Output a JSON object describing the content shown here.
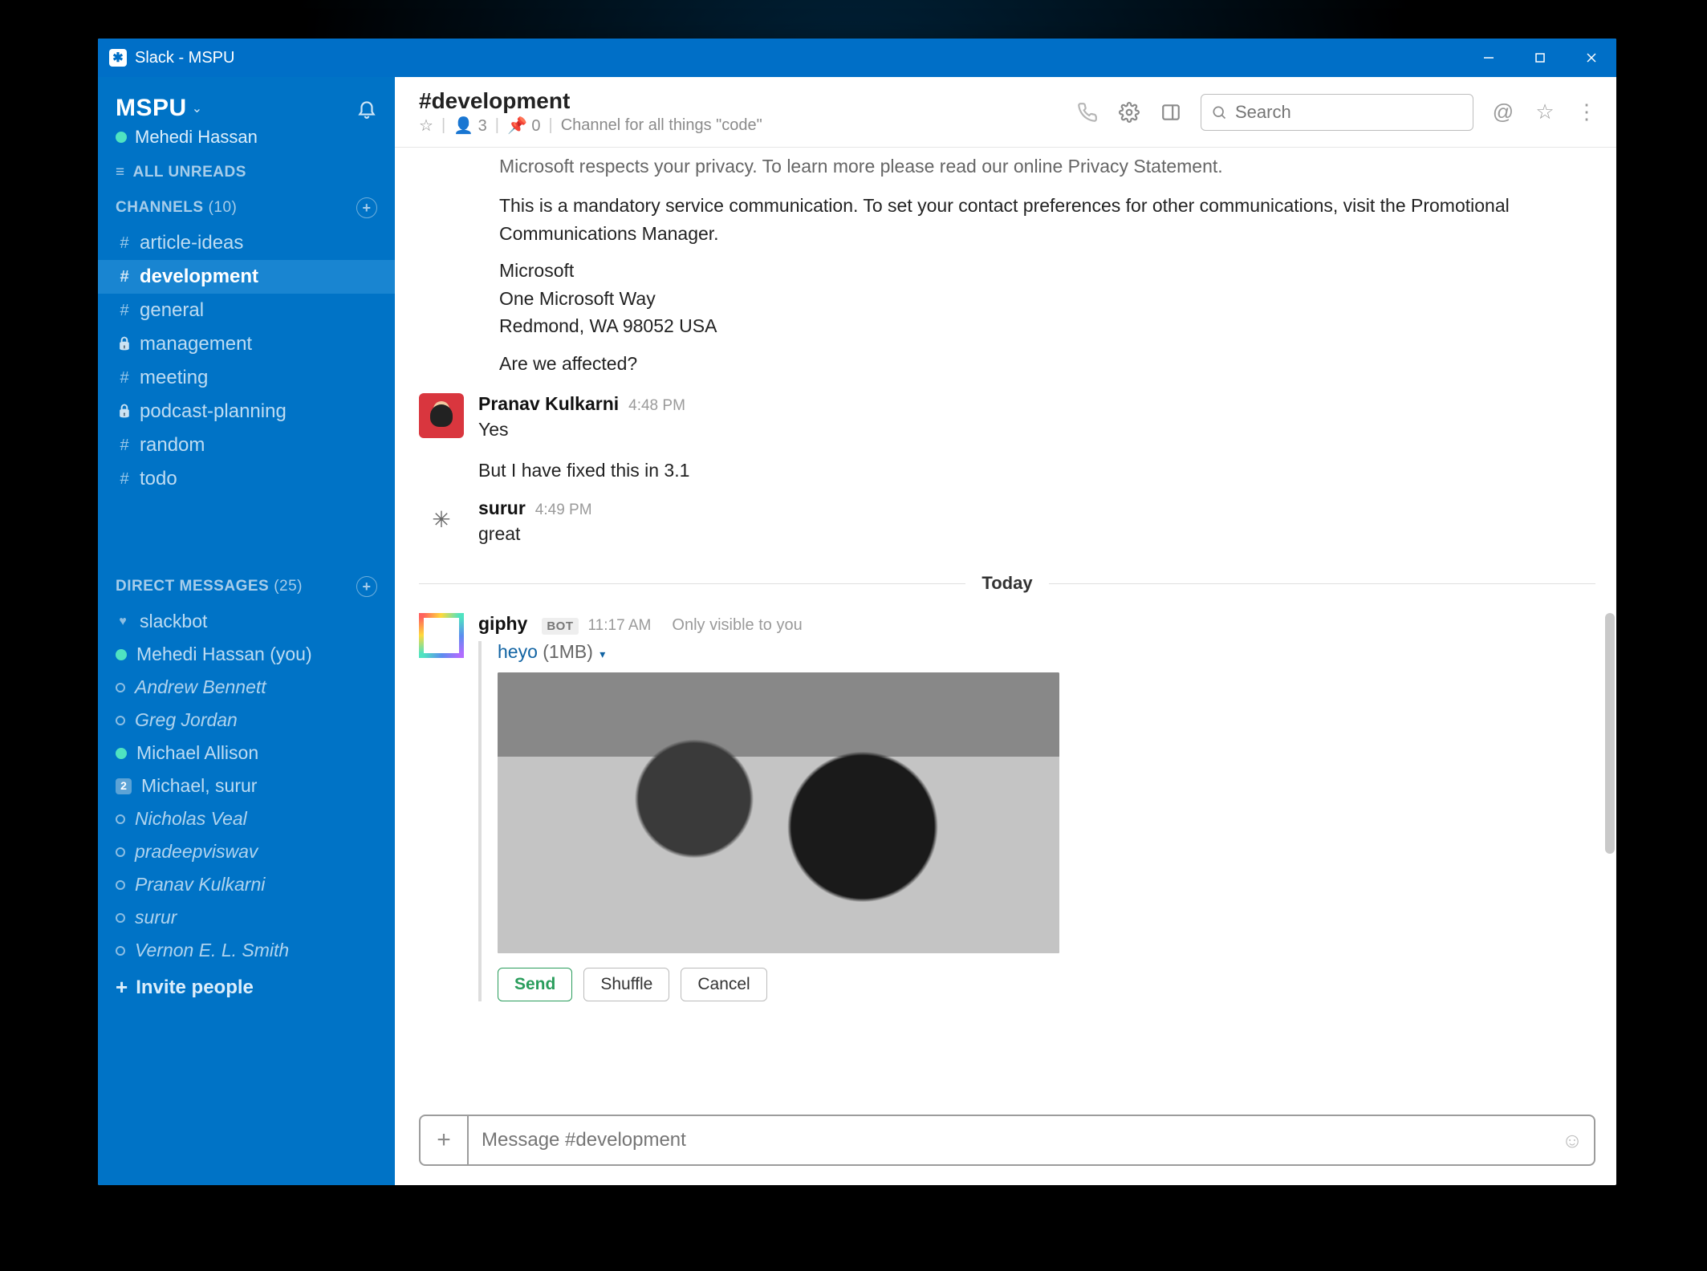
{
  "window": {
    "title": "Slack - MSPU"
  },
  "workspace": {
    "name": "MSPU",
    "user": "Mehedi Hassan"
  },
  "sidebar": {
    "allunreads": "ALL UNREADS",
    "channels_label": "CHANNELS",
    "channels_count": "(10)",
    "channels": [
      {
        "name": "article-ideas",
        "type": "hash"
      },
      {
        "name": "development",
        "type": "hash",
        "active": true
      },
      {
        "name": "general",
        "type": "hash"
      },
      {
        "name": "management",
        "type": "lock"
      },
      {
        "name": "meeting",
        "type": "hash"
      },
      {
        "name": "podcast-planning",
        "type": "lock"
      },
      {
        "name": "random",
        "type": "hash"
      },
      {
        "name": "todo",
        "type": "hash"
      }
    ],
    "dm_label": "DIRECT MESSAGES",
    "dm_count": "(25)",
    "dms": [
      {
        "name": "slackbot",
        "pre": "heart"
      },
      {
        "name": "Mehedi Hassan (you)",
        "pre": "dot-on"
      },
      {
        "name": "Andrew Bennett",
        "pre": "dot-off",
        "italic": true
      },
      {
        "name": "Greg Jordan",
        "pre": "dot-off",
        "italic": true
      },
      {
        "name": "Michael Allison",
        "pre": "dot-on"
      },
      {
        "name": "Michael, surur",
        "pre": "badge",
        "badge": "2"
      },
      {
        "name": "Nicholas Veal",
        "pre": "dot-off",
        "italic": true
      },
      {
        "name": "pradeepviswav",
        "pre": "dot-off",
        "italic": true
      },
      {
        "name": "Pranav Kulkarni",
        "pre": "dot-off",
        "italic": true
      },
      {
        "name": "surur",
        "pre": "dot-off",
        "italic": true
      },
      {
        "name": "Vernon E. L. Smith",
        "pre": "dot-off",
        "italic": true
      }
    ],
    "invite": "Invite people"
  },
  "channel": {
    "name": "#development",
    "members": "3",
    "pins": "0",
    "topic": "Channel for all things \"code\""
  },
  "search": {
    "placeholder": "Search"
  },
  "messages": {
    "cutoff": "Microsoft respects your privacy. To learn more please read our online Privacy Statement.",
    "p1": "This is a mandatory service communication. To set your contact preferences for other communications, visit the Promotional Communications Manager.",
    "p2a": "Microsoft",
    "p2b": "One Microsoft Way",
    "p2c": "Redmond, WA 98052 USA",
    "p3": "Are we affected?",
    "m1": {
      "user": "Pranav Kulkarni",
      "time": "4:48 PM",
      "l1": "Yes",
      "l2": "But I have fixed this in 3.1"
    },
    "m2": {
      "user": "surur",
      "time": "4:49 PM",
      "l1": "great"
    },
    "divider": "Today",
    "m3": {
      "user": "giphy",
      "bot": "BOT",
      "time": "11:17 AM",
      "note": "Only visible to you",
      "att_title": "heyo",
      "att_size": "(1MB)",
      "btn_send": "Send",
      "btn_shuffle": "Shuffle",
      "btn_cancel": "Cancel"
    }
  },
  "composer": {
    "placeholder": "Message #development"
  }
}
